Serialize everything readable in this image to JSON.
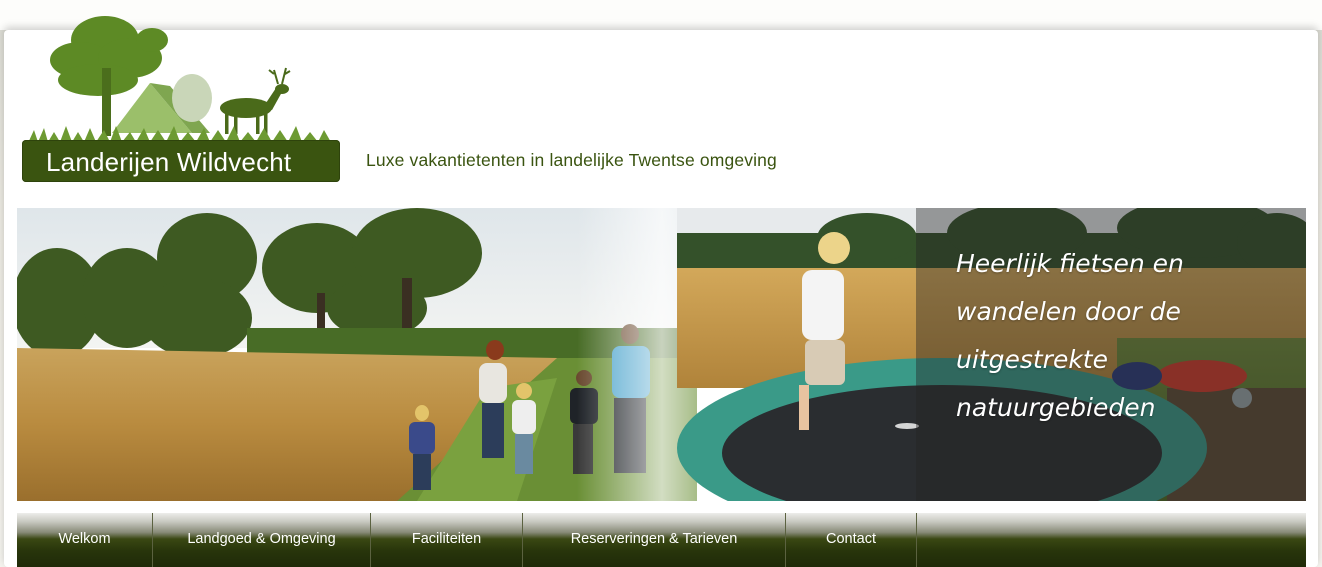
{
  "brand": {
    "name": "Landerijen Wildvecht",
    "tagline": "Luxe vakantietenten in landelijke Twentse omgeving",
    "color_dark_green": "#3a5410",
    "color_leaf_green": "#5d8a25"
  },
  "banner": {
    "caption_lines": [
      "Heerlijk fietsen en",
      "wandelen door de",
      "uitgestrekte",
      "natuurgebieden"
    ]
  },
  "nav": {
    "items": [
      {
        "label": "Welkom"
      },
      {
        "label": "Landgoed & Omgeving"
      },
      {
        "label": "Faciliteiten"
      },
      {
        "label": "Reserveringen & Tarieven"
      },
      {
        "label": "Contact"
      }
    ]
  }
}
